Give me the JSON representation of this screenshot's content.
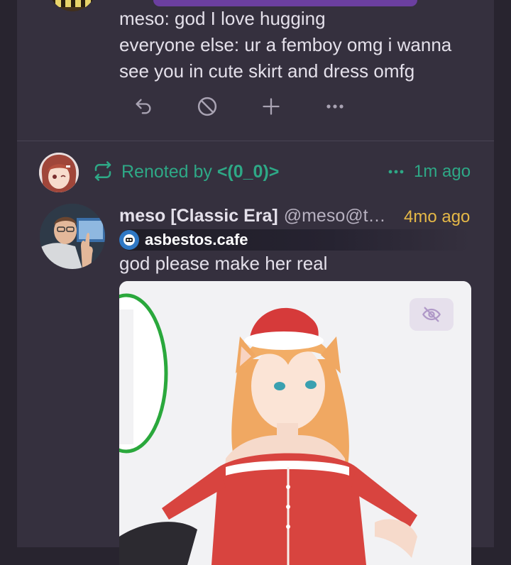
{
  "prev_note": {
    "lines": [
      "meso: god I love hugging",
      "everyone else: ur a femboy omg i wanna",
      "see you in cute skirt and dress omfg"
    ],
    "actions": [
      "reply-icon",
      "block-icon",
      "plus-icon",
      "more-icon"
    ]
  },
  "renote": {
    "prefix": "Renoted by ",
    "user": "<(0_0)>",
    "time": "1m ago"
  },
  "note": {
    "author_name": "meso [Classic Era]",
    "author_handle": "@meso@t…",
    "time": "4mo ago",
    "instance": "asbestos.cafe",
    "text": "god please make her real"
  },
  "colors": {
    "background": "#28242f",
    "column": "#35303e",
    "renote_accent": "#2ea886",
    "time_accent": "#e5b847"
  }
}
